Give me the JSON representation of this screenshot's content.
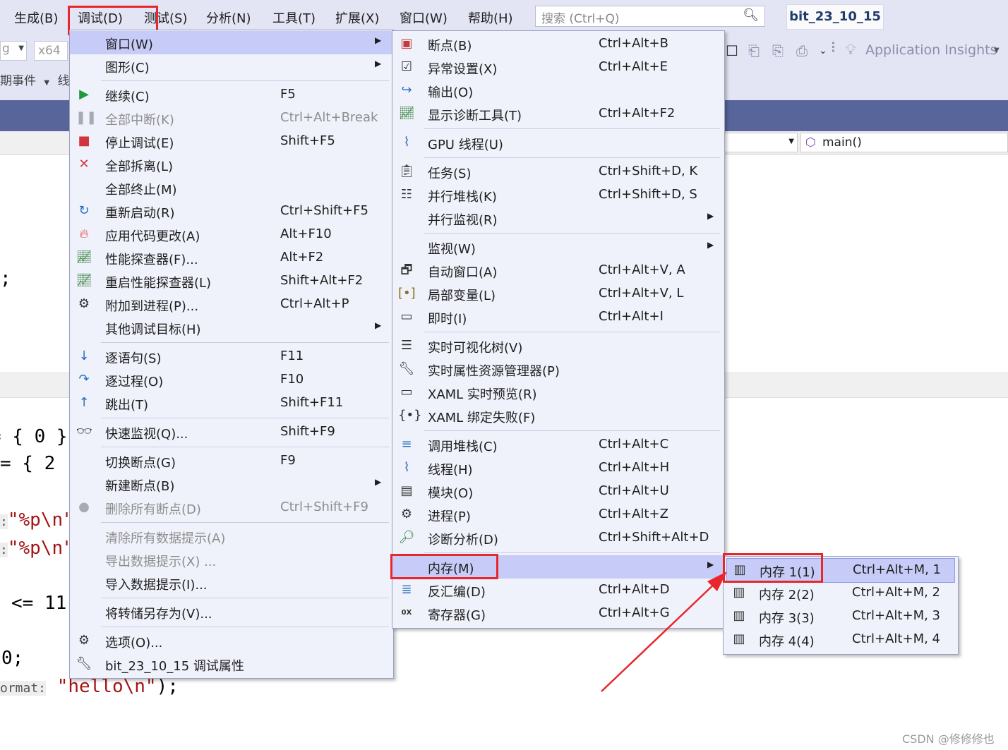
{
  "menubar": {
    "items": [
      "生成(B)",
      "调试(D)",
      "测试(S)",
      "分析(N)",
      "工具(T)",
      "扩展(X)",
      "窗口(W)",
      "帮助(H)"
    ],
    "search_placeholder": "搜索 (Ctrl+Q)",
    "project_name": "bit_23_10_15"
  },
  "toolbar": {
    "platform": "x64",
    "config_partial": "g",
    "events_label": "期事件",
    "thread_label": "线",
    "app_insights": "Application Insights"
  },
  "navbar": {
    "function_name": "main()"
  },
  "code_fragments": {
    "semicolon1": ";",
    "init1": "= { 0 }",
    "init2": "= { 2",
    "printf1_hint": ":",
    "printf1_str": "\"%p\\n\"",
    "printf2_hint": ":",
    "printf2_str": "\"%p\\n\"",
    "loop": "<= 11",
    "ret": "0;",
    "format_hint": "ormat:",
    "hello_str": "\"hello\\n\"",
    "hello_end": ");"
  },
  "debug_menu": {
    "items": [
      {
        "label": "窗口(W)",
        "shortcut": "",
        "icon": "",
        "submenu": true,
        "highlighted": true
      },
      {
        "label": "图形(C)",
        "shortcut": "",
        "icon": "",
        "submenu": true
      },
      {
        "label": "继续(C)",
        "shortcut": "F5",
        "icon": "play-icon"
      },
      {
        "label": "全部中断(K)",
        "shortcut": "Ctrl+Alt+Break",
        "icon": "pause-icon",
        "disabled": true
      },
      {
        "label": "停止调试(E)",
        "shortcut": "Shift+F5",
        "icon": "stop-icon"
      },
      {
        "label": "全部拆离(L)",
        "shortcut": "",
        "icon": "detach-x-icon"
      },
      {
        "label": "全部终止(M)",
        "shortcut": "",
        "icon": ""
      },
      {
        "label": "重新启动(R)",
        "shortcut": "Ctrl+Shift+F5",
        "icon": "restart-icon"
      },
      {
        "label": "应用代码更改(A)",
        "shortcut": "Alt+F10",
        "icon": "hot-reload-icon"
      },
      {
        "label": "性能探查器(F)...",
        "shortcut": "Alt+F2",
        "icon": "profiler-icon"
      },
      {
        "label": "重启性能探查器(L)",
        "shortcut": "Shift+Alt+F2",
        "icon": "profiler-restart-icon"
      },
      {
        "label": "附加到进程(P)...",
        "shortcut": "Ctrl+Alt+P",
        "icon": "attach-gears-icon"
      },
      {
        "label": "其他调试目标(H)",
        "shortcut": "",
        "icon": "",
        "submenu": true
      },
      {
        "label": "逐语句(S)",
        "shortcut": "F11",
        "icon": "step-into-icon"
      },
      {
        "label": "逐过程(O)",
        "shortcut": "F10",
        "icon": "step-over-icon"
      },
      {
        "label": "跳出(T)",
        "shortcut": "Shift+F11",
        "icon": "step-out-icon"
      },
      {
        "label": "快速监视(Q)...",
        "shortcut": "Shift+F9",
        "icon": "glasses-icon"
      },
      {
        "label": "切换断点(G)",
        "shortcut": "F9",
        "icon": ""
      },
      {
        "label": "新建断点(B)",
        "shortcut": "",
        "icon": "",
        "submenu": true
      },
      {
        "label": "删除所有断点(D)",
        "shortcut": "Ctrl+Shift+F9",
        "icon": "delete-breakpoints-icon",
        "disabled": true
      },
      {
        "label": "清除所有数据提示(A)",
        "shortcut": "",
        "icon": "",
        "disabled": true
      },
      {
        "label": "导出数据提示(X) ...",
        "shortcut": "",
        "icon": "",
        "disabled": true
      },
      {
        "label": "导入数据提示(I)...",
        "shortcut": "",
        "icon": ""
      },
      {
        "label": "将转储另存为(V)...",
        "shortcut": "",
        "icon": ""
      },
      {
        "label": "选项(O)...",
        "shortcut": "",
        "icon": "gear-icon"
      },
      {
        "label": "bit_23_10_15 调试属性",
        "shortcut": "",
        "icon": "wrench-icon"
      }
    ]
  },
  "window_menu": {
    "items": [
      {
        "label": "断点(B)",
        "shortcut": "Ctrl+Alt+B",
        "icon": "breakpoints-window-icon"
      },
      {
        "label": "异常设置(X)",
        "shortcut": "Ctrl+Alt+E",
        "icon": "exception-settings-icon"
      },
      {
        "label": "输出(O)",
        "shortcut": "",
        "icon": "output-icon"
      },
      {
        "label": "显示诊断工具(T)",
        "shortcut": "Ctrl+Alt+F2",
        "icon": "diagnostic-tools-icon"
      },
      {
        "label": "GPU 线程(U)",
        "shortcut": "",
        "icon": "gpu-threads-icon"
      },
      {
        "label": "任务(S)",
        "shortcut": "Ctrl+Shift+D, K",
        "icon": "tasks-icon"
      },
      {
        "label": "并行堆栈(K)",
        "shortcut": "Ctrl+Shift+D, S",
        "icon": "parallel-stacks-icon"
      },
      {
        "label": "并行监视(R)",
        "shortcut": "",
        "icon": "",
        "submenu": true
      },
      {
        "label": "监视(W)",
        "shortcut": "",
        "icon": "",
        "submenu": true
      },
      {
        "label": "自动窗口(A)",
        "shortcut": "Ctrl+Alt+V, A",
        "icon": "autos-icon"
      },
      {
        "label": "局部变量(L)",
        "shortcut": "Ctrl+Alt+V, L",
        "icon": "locals-icon"
      },
      {
        "label": "即时(I)",
        "shortcut": "Ctrl+Alt+I",
        "icon": "immediate-icon"
      },
      {
        "label": "实时可视化树(V)",
        "shortcut": "",
        "icon": "visual-tree-icon"
      },
      {
        "label": "实时属性资源管理器(P)",
        "shortcut": "",
        "icon": "property-explorer-icon"
      },
      {
        "label": "XAML 实时预览(R)",
        "shortcut": "",
        "icon": "xaml-preview-icon"
      },
      {
        "label": "XAML 绑定失败(F)",
        "shortcut": "",
        "icon": "xaml-binding-icon"
      },
      {
        "label": "调用堆栈(C)",
        "shortcut": "Ctrl+Alt+C",
        "icon": "call-stack-icon"
      },
      {
        "label": "线程(H)",
        "shortcut": "Ctrl+Alt+H",
        "icon": "threads-icon"
      },
      {
        "label": "模块(O)",
        "shortcut": "Ctrl+Alt+U",
        "icon": "modules-icon"
      },
      {
        "label": "进程(P)",
        "shortcut": "Ctrl+Alt+Z",
        "icon": "processes-icon"
      },
      {
        "label": "诊断分析(D)",
        "shortcut": "Ctrl+Shift+Alt+D",
        "icon": "diagnostic-analysis-icon"
      },
      {
        "label": "内存(M)",
        "shortcut": "",
        "icon": "",
        "submenu": true,
        "highlighted": true
      },
      {
        "label": "反汇编(D)",
        "shortcut": "Ctrl+Alt+D",
        "icon": "disassembly-icon"
      },
      {
        "label": "寄存器(G)",
        "shortcut": "Ctrl+Alt+G",
        "icon": "registers-icon"
      }
    ]
  },
  "memory_menu": {
    "items": [
      {
        "label": "内存 1(1)",
        "shortcut": "Ctrl+Alt+M, 1",
        "icon": "memory-chip-icon",
        "highlighted": true
      },
      {
        "label": "内存 2(2)",
        "shortcut": "Ctrl+Alt+M, 2",
        "icon": "memory-chip-icon"
      },
      {
        "label": "内存 3(3)",
        "shortcut": "Ctrl+Alt+M, 3",
        "icon": "memory-chip-icon"
      },
      {
        "label": "内存 4(4)",
        "shortcut": "Ctrl+Alt+M, 4",
        "icon": "memory-chip-icon"
      }
    ]
  },
  "watermark": "CSDN @修修修也",
  "colors": {
    "annotation_red": "#e8262b",
    "highlight": "#c6ccf7",
    "menu_bg": "#f0f2fb"
  }
}
